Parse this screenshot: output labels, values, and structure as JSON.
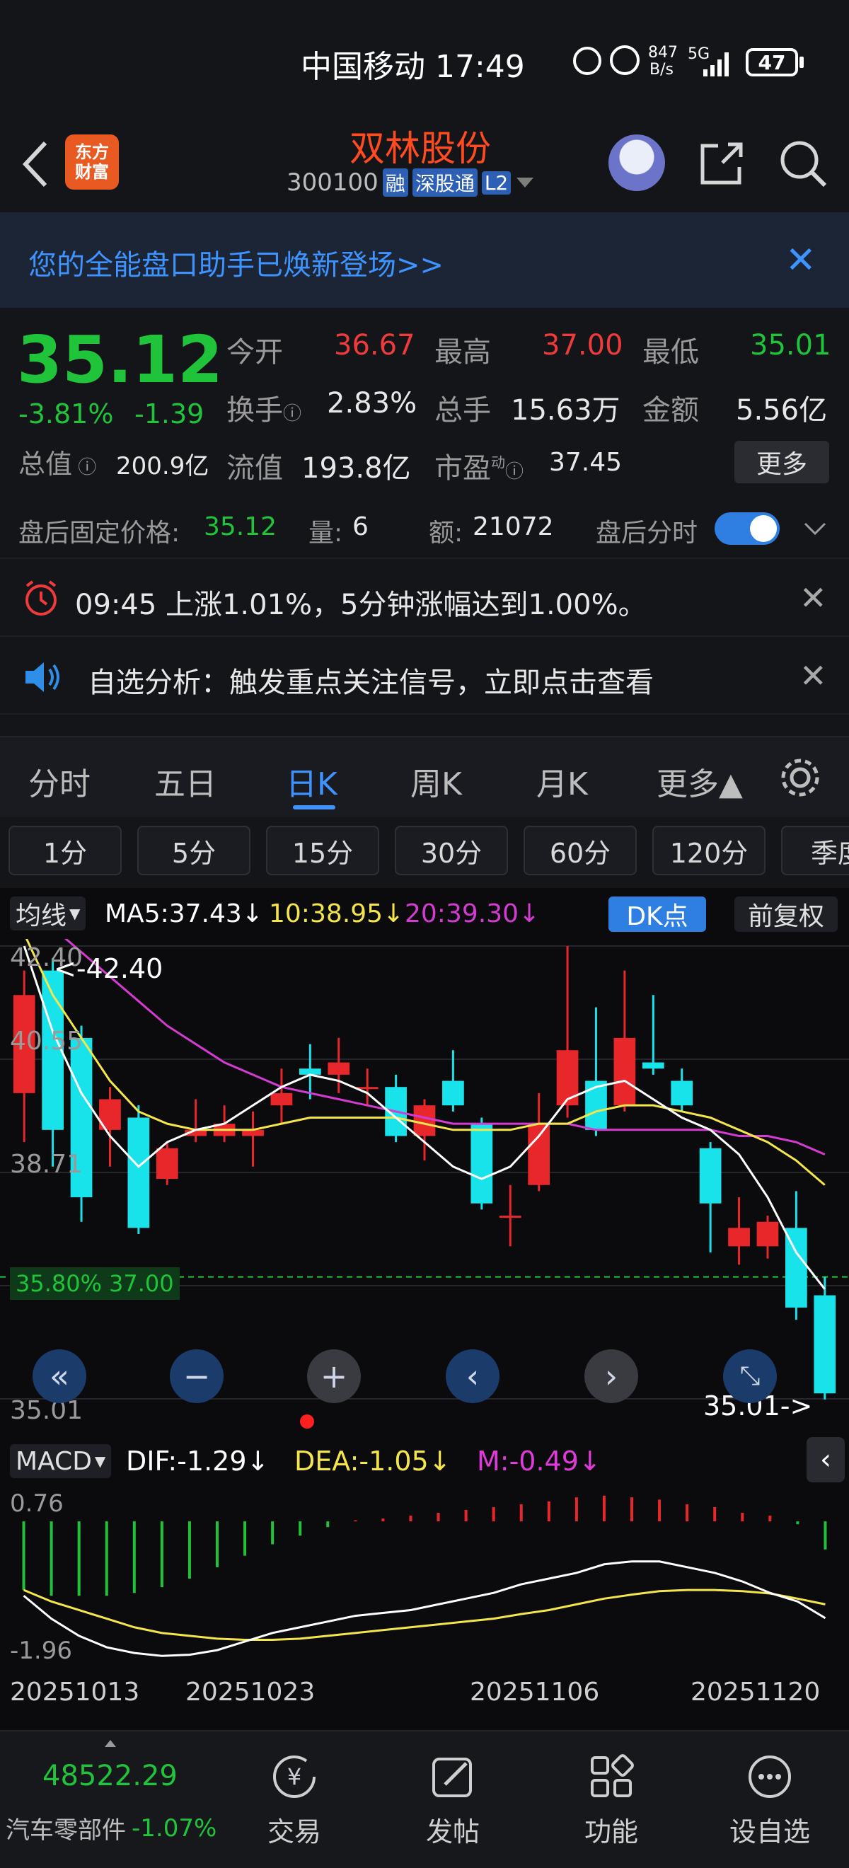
{
  "status": {
    "carrier_time": "中国移动 17:49",
    "net_speed_value": "847",
    "net_speed_unit": "B/s",
    "network": "5G",
    "battery": "47"
  },
  "title": {
    "stock_name": "双林股份",
    "code": "300100",
    "tag_rong": "融",
    "tag_sgt": "深股通",
    "tag_l2": "L2",
    "logo_line1": "东方",
    "logo_line2": "财富"
  },
  "banner": {
    "text": "您的全能盘口助手已焕新登场>>"
  },
  "quote": {
    "price": "35.12",
    "change_pct": "-3.81%",
    "change_abs": "-1.39",
    "open_label": "今开",
    "open": "36.67",
    "high_label": "最高",
    "high": "37.00",
    "low_label": "最低",
    "low": "35.01",
    "turnover_label": "换手",
    "turnover": "2.83%",
    "volume_label": "总手",
    "volume": "15.63万",
    "amount_label": "金额",
    "amount": "5.56亿",
    "mcap_label": "总值",
    "mcap": "200.9亿",
    "float_label": "流值",
    "float": "193.8亿",
    "pe_label": "市盈",
    "pe_sup": "动",
    "pe": "37.45",
    "more": "更多"
  },
  "after_hours": {
    "price_label": "盘后固定价格:",
    "price": "35.12",
    "vol_label": "量:",
    "vol": "6",
    "amt_label": "额:",
    "amt": "21072",
    "toggle_label": "盘后分时"
  },
  "notices": {
    "alert": "09:45 上涨1.01%，5分钟涨幅达到1.00%。",
    "analysis": "自选分析：触发重点关注信号，立即点击查看"
  },
  "tabs": [
    "分时",
    "五日",
    "日K",
    "周K",
    "月K",
    "更多▲"
  ],
  "active_tab": "日K",
  "periods": [
    "1分",
    "5分",
    "15分",
    "30分",
    "60分",
    "120分",
    "季度"
  ],
  "ma_bar": {
    "dropdown": "均线",
    "ma5": "MA5:37.43↓",
    "ma10": "10:38.95↓",
    "ma20": "20:39.30↓",
    "dk": "DK点",
    "adjust": "前复权"
  },
  "colors": {
    "ma5": "#ffffff",
    "ma10": "#f4e64a",
    "ma20": "#d43bd1",
    "up": "#e8272b",
    "down": "#19e3ea",
    "accent": "#2f7fe3"
  },
  "kchart": {
    "y_labels": [
      "42.40",
      "40.55",
      "38.71",
      "35.01"
    ],
    "max_marker": "<-42.40",
    "min_marker": "35.01->",
    "price_line_label": "37.00",
    "price_line_label_prefix": "35.80%"
  },
  "macd": {
    "dropdown": "MACD",
    "dif": "DIF:-1.29↓",
    "dea": "DEA:-1.05↓",
    "m": "M:-0.49↓",
    "y_top": "0.76",
    "y_bottom": "-1.96"
  },
  "dates": [
    "20251013",
    "20251023",
    "20251106",
    "20251120"
  ],
  "bottom": {
    "index_value": "48522.29",
    "index_name": "汽车零部件",
    "index_change": "-1.07%",
    "nav": [
      "交易",
      "发帖",
      "功能",
      "设自选"
    ]
  },
  "chart_data": {
    "type": "candlestick",
    "x": [
      "c1",
      "c2",
      "c3",
      "c4",
      "c5",
      "c6",
      "c7",
      "c8",
      "c9",
      "c10",
      "c11",
      "c12",
      "c13",
      "c14",
      "c15",
      "c16",
      "c17",
      "c18",
      "c19",
      "c20",
      "c21",
      "c22",
      "c23",
      "c24",
      "c25",
      "c26",
      "c27",
      "c28"
    ],
    "ylim": [
      35.01,
      42.4
    ],
    "candles": [
      {
        "o": 40.0,
        "c": 41.6,
        "h": 42.0,
        "l": 39.2
      },
      {
        "o": 42.0,
        "c": 39.4,
        "h": 42.2,
        "l": 38.8
      },
      {
        "o": 40.9,
        "c": 38.3,
        "h": 41.1,
        "l": 37.9
      },
      {
        "o": 39.4,
        "c": 39.9,
        "h": 40.1,
        "l": 38.8
      },
      {
        "o": 39.6,
        "c": 37.8,
        "h": 39.8,
        "l": 37.7
      },
      {
        "o": 38.6,
        "c": 39.1,
        "h": 39.2,
        "l": 38.5
      },
      {
        "o": 39.3,
        "c": 39.4,
        "h": 39.9,
        "l": 39.2
      },
      {
        "o": 39.3,
        "c": 39.5,
        "h": 39.8,
        "l": 39.2
      },
      {
        "o": 39.3,
        "c": 39.4,
        "h": 39.7,
        "l": 38.8
      },
      {
        "o": 39.8,
        "c": 40.0,
        "h": 40.4,
        "l": 39.5
      },
      {
        "o": 40.4,
        "c": 40.3,
        "h": 40.8,
        "l": 39.9
      },
      {
        "o": 40.3,
        "c": 40.5,
        "h": 40.9,
        "l": 40.0
      },
      {
        "o": 40.1,
        "c": 40.1,
        "h": 40.4,
        "l": 39.8
      },
      {
        "o": 40.1,
        "c": 39.3,
        "h": 40.3,
        "l": 39.2
      },
      {
        "o": 39.3,
        "c": 39.8,
        "h": 39.9,
        "l": 38.9
      },
      {
        "o": 40.2,
        "c": 39.8,
        "h": 40.7,
        "l": 39.7
      },
      {
        "o": 39.5,
        "c": 38.2,
        "h": 39.6,
        "l": 38.1
      },
      {
        "o": 38.0,
        "c": 38.0,
        "h": 38.5,
        "l": 37.5
      },
      {
        "o": 38.5,
        "c": 39.5,
        "h": 40.0,
        "l": 38.4
      },
      {
        "o": 39.8,
        "c": 40.7,
        "h": 42.4,
        "l": 39.6
      },
      {
        "o": 40.2,
        "c": 39.4,
        "h": 41.4,
        "l": 39.3
      },
      {
        "o": 39.8,
        "c": 40.9,
        "h": 42.0,
        "l": 39.7
      },
      {
        "o": 40.5,
        "c": 40.4,
        "h": 41.6,
        "l": 40.3
      },
      {
        "o": 40.2,
        "c": 39.8,
        "h": 40.4,
        "l": 39.7
      },
      {
        "o": 39.1,
        "c": 38.2,
        "h": 39.2,
        "l": 37.4
      },
      {
        "o": 37.5,
        "c": 37.8,
        "h": 38.3,
        "l": 37.2
      },
      {
        "o": 37.5,
        "c": 37.9,
        "h": 38.0,
        "l": 37.3
      },
      {
        "o": 37.8,
        "c": 36.5,
        "h": 38.4,
        "l": 36.3
      },
      {
        "o": 36.7,
        "c": 35.1,
        "h": 37.0,
        "l": 35.0
      }
    ],
    "ma5": [
      42.4,
      41.0,
      40.0,
      39.3,
      38.8,
      39.2,
      39.4,
      39.5,
      39.8,
      40.1,
      40.3,
      40.2,
      40.0,
      39.6,
      39.2,
      38.8,
      38.6,
      38.8,
      39.3,
      39.9,
      40.1,
      40.2,
      39.9,
      39.6,
      39.4,
      39.0,
      38.3,
      37.4,
      36.8
    ],
    "ma10": [
      42.6,
      41.6,
      40.9,
      40.2,
      39.7,
      39.5,
      39.4,
      39.4,
      39.4,
      39.5,
      39.6,
      39.6,
      39.6,
      39.6,
      39.5,
      39.4,
      39.4,
      39.4,
      39.5,
      39.5,
      39.7,
      39.8,
      39.8,
      39.7,
      39.6,
      39.4,
      39.2,
      38.9,
      38.5
    ],
    "ma20": [
      43.0,
      42.7,
      42.3,
      41.9,
      41.5,
      41.1,
      40.8,
      40.5,
      40.3,
      40.1,
      40.0,
      39.9,
      39.8,
      39.7,
      39.6,
      39.5,
      39.5,
      39.5,
      39.5,
      39.5,
      39.4,
      39.4,
      39.4,
      39.4,
      39.4,
      39.3,
      39.3,
      39.2,
      39.0
    ],
    "macd_ylim": [
      -1.96,
      0.76
    ],
    "macd_hist": [
      -1.2,
      -1.3,
      -1.3,
      -1.3,
      -1.25,
      -1.15,
      -1.0,
      -0.8,
      -0.6,
      -0.4,
      -0.25,
      -0.1,
      0.02,
      0.05,
      0.1,
      0.15,
      0.2,
      0.25,
      0.3,
      0.35,
      0.42,
      0.45,
      0.42,
      0.38,
      0.3,
      0.25,
      0.15,
      0.1,
      -0.05,
      -0.49
    ],
    "dif": [
      -0.9,
      -1.3,
      -1.6,
      -1.8,
      -1.9,
      -1.95,
      -1.93,
      -1.85,
      -1.7,
      -1.55,
      -1.45,
      -1.35,
      -1.25,
      -1.2,
      -1.15,
      -1.05,
      -0.95,
      -0.85,
      -0.7,
      -0.6,
      -0.5,
      -0.35,
      -0.3,
      -0.3,
      -0.4,
      -0.5,
      -0.65,
      -0.85,
      -1.0,
      -1.29
    ],
    "dea": [
      -0.8,
      -1.0,
      -1.15,
      -1.3,
      -1.45,
      -1.55,
      -1.6,
      -1.65,
      -1.67,
      -1.67,
      -1.65,
      -1.6,
      -1.55,
      -1.5,
      -1.45,
      -1.4,
      -1.35,
      -1.3,
      -1.22,
      -1.15,
      -1.05,
      -0.95,
      -0.88,
      -0.82,
      -0.8,
      -0.8,
      -0.82,
      -0.86,
      -0.95,
      -1.05
    ]
  }
}
